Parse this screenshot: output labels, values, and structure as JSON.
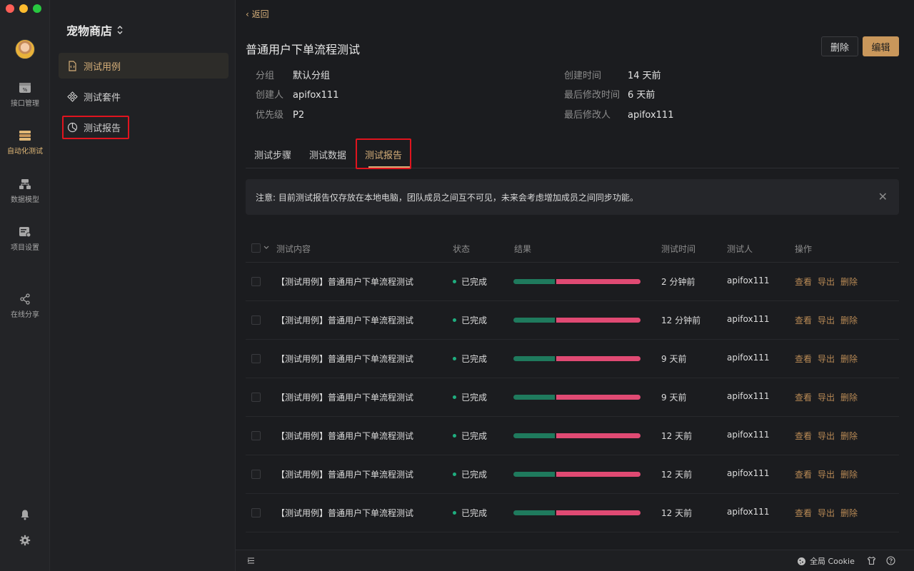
{
  "rail": {
    "items": [
      {
        "label": "接口管理",
        "icon": "api-icon"
      },
      {
        "label": "自动化测试",
        "icon": "automation-icon"
      },
      {
        "label": "数据模型",
        "icon": "data-model-icon"
      },
      {
        "label": "项目设置",
        "icon": "project-settings-icon"
      },
      {
        "label": "在线分享",
        "icon": "share-icon"
      }
    ],
    "active_index": 1
  },
  "sidebar": {
    "project_title": "宠物商店",
    "items": [
      {
        "label": "测试用例",
        "icon": "file-code-icon"
      },
      {
        "label": "测试套件",
        "icon": "suite-icon"
      },
      {
        "label": "测试报告",
        "icon": "pie-chart-icon"
      }
    ],
    "active_index": 0
  },
  "header": {
    "back_label": "返回",
    "title": "普通用户下单流程测试",
    "delete_label": "删除",
    "edit_label": "编辑"
  },
  "meta": {
    "group_key": "分组",
    "group_value": "默认分组",
    "creator_key": "创建人",
    "creator_value": "apifox111",
    "priority_key": "优先级",
    "priority_value": "P2",
    "created_key": "创建时间",
    "created_value": "14 天前",
    "modified_key": "最后修改时间",
    "modified_value": "6 天前",
    "modifier_key": "最后修改人",
    "modifier_value": "apifox111"
  },
  "tabs": [
    {
      "label": "测试步骤"
    },
    {
      "label": "测试数据"
    },
    {
      "label": "测试报告"
    }
  ],
  "active_tab": 2,
  "notice": {
    "text": "注意: 目前测试报告仅存放在本地电脑，团队成员之间互不可见，未来会考虑增加成员之间同步功能。"
  },
  "table": {
    "headers": {
      "content": "测试内容",
      "status": "状态",
      "result": "结果",
      "time": "测试时间",
      "tester": "测试人",
      "actions": "操作"
    },
    "rows": [
      {
        "content": "【测试用例】普通用户下单流程测试",
        "status": "已完成",
        "pass_fraction": 0.33,
        "time": "2 分钟前",
        "tester": "apifox111"
      },
      {
        "content": "【测试用例】普通用户下单流程测试",
        "status": "已完成",
        "pass_fraction": 0.33,
        "time": "12 分钟前",
        "tester": "apifox111"
      },
      {
        "content": "【测试用例】普通用户下单流程测试",
        "status": "已完成",
        "pass_fraction": 0.33,
        "time": "9 天前",
        "tester": "apifox111"
      },
      {
        "content": "【测试用例】普通用户下单流程测试",
        "status": "已完成",
        "pass_fraction": 0.33,
        "time": "9 天前",
        "tester": "apifox111"
      },
      {
        "content": "【测试用例】普通用户下单流程测试",
        "status": "已完成",
        "pass_fraction": 0.33,
        "time": "12 天前",
        "tester": "apifox111"
      },
      {
        "content": "【测试用例】普通用户下单流程测试",
        "status": "已完成",
        "pass_fraction": 0.33,
        "time": "12 天前",
        "tester": "apifox111"
      },
      {
        "content": "【测试用例】普通用户下单流程测试",
        "status": "已完成",
        "pass_fraction": 0.33,
        "time": "12 天前",
        "tester": "apifox111"
      }
    ],
    "action_labels": {
      "view": "查看",
      "export": "导出",
      "delete": "删除"
    }
  },
  "footer": {
    "cookie_label": "全局 Cookie"
  },
  "colors": {
    "accent": "#d7b07a",
    "pass": "#1f7a5d",
    "fail": "#e04a73",
    "status_done": "#1fae7f",
    "highlight": "#e0141e"
  }
}
